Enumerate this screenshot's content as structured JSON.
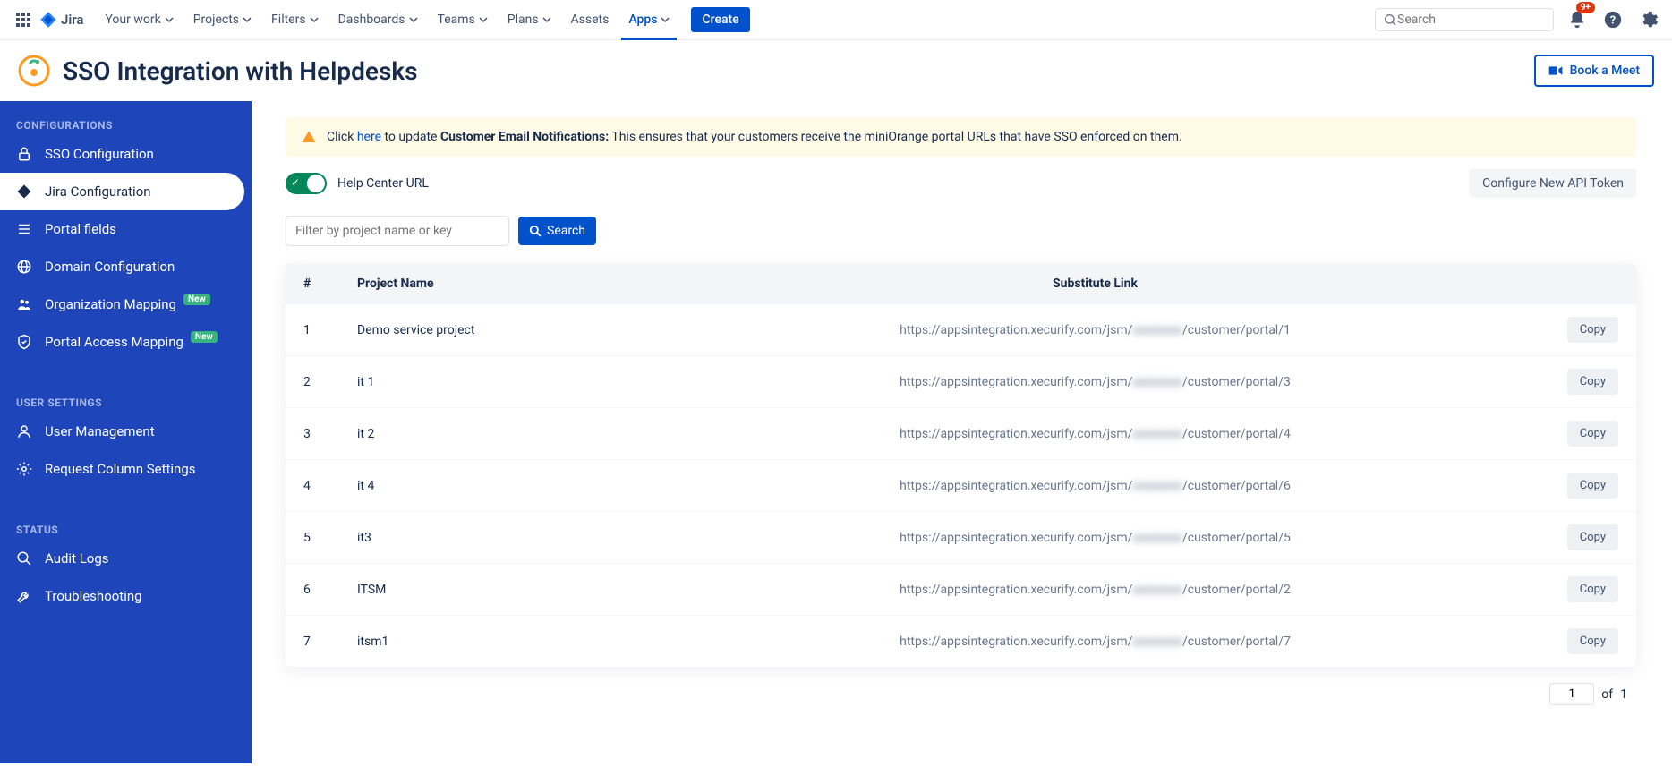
{
  "top_nav": {
    "brand": "Jira",
    "items": [
      {
        "label": "Your work",
        "dropdown": true,
        "active": false
      },
      {
        "label": "Projects",
        "dropdown": true,
        "active": false
      },
      {
        "label": "Filters",
        "dropdown": true,
        "active": false
      },
      {
        "label": "Dashboards",
        "dropdown": true,
        "active": false
      },
      {
        "label": "Teams",
        "dropdown": true,
        "active": false
      },
      {
        "label": "Plans",
        "dropdown": true,
        "active": false
      },
      {
        "label": "Assets",
        "dropdown": false,
        "active": false
      },
      {
        "label": "Apps",
        "dropdown": true,
        "active": true
      }
    ],
    "create": "Create",
    "search_placeholder": "Search",
    "notifications_badge": "9+"
  },
  "header": {
    "title": "SSO Integration with Helpdesks",
    "book_meet": "Book a Meet"
  },
  "sidebar": {
    "configurations": {
      "heading": "CONFIGURATIONS",
      "items": [
        {
          "icon": "lock-icon",
          "label": "SSO Configuration",
          "active": false,
          "new": false,
          "name": "sidebar-item-sso-config"
        },
        {
          "icon": "jira-icon",
          "label": "Jira Configuration",
          "active": true,
          "new": false,
          "name": "sidebar-item-jira-config"
        },
        {
          "icon": "list-icon",
          "label": "Portal fields",
          "active": false,
          "new": false,
          "name": "sidebar-item-portal-fields"
        },
        {
          "icon": "globe-icon",
          "label": "Domain Configuration",
          "active": false,
          "new": false,
          "name": "sidebar-item-domain-config"
        },
        {
          "icon": "users-icon",
          "label": "Organization Mapping",
          "active": false,
          "new": true,
          "name": "sidebar-item-org-mapping"
        },
        {
          "icon": "shield-icon",
          "label": "Portal Access Mapping",
          "active": false,
          "new": true,
          "name": "sidebar-item-portal-access"
        }
      ]
    },
    "user_settings": {
      "heading": "USER SETTINGS",
      "items": [
        {
          "icon": "person-icon",
          "label": "User Management",
          "name": "sidebar-item-user-management"
        },
        {
          "icon": "gear-icon",
          "label": "Request Column Settings",
          "name": "sidebar-item-request-column"
        }
      ]
    },
    "status": {
      "heading": "STATUS",
      "items": [
        {
          "icon": "search-icon",
          "label": "Audit Logs",
          "name": "sidebar-item-audit-logs"
        },
        {
          "icon": "wrench-icon",
          "label": "Troubleshooting",
          "name": "sidebar-item-troubleshooting"
        }
      ]
    },
    "new_badge_text": "New"
  },
  "alert": {
    "prefix": "Click ",
    "link": "here",
    "mid": " to update ",
    "strong": "Customer Email Notifications:",
    "rest": " This ensures that your customers receive the miniOrange portal URLs that have SSO enforced on them."
  },
  "controls": {
    "help_center": "Help Center URL",
    "api_token": "Configure New API Token"
  },
  "filter": {
    "placeholder": "Filter by project name or key",
    "search": "Search"
  },
  "table": {
    "headers": {
      "num": "#",
      "project": "Project Name",
      "link": "Substitute Link"
    },
    "copy_label": "Copy",
    "link_prefix": "https://appsintegration.xecurify.com/jsm/",
    "link_blur": "xxxxxxxx",
    "link_suffix_base": "/customer/portal/",
    "rows": [
      {
        "num": "1",
        "name": "Demo service project",
        "portal": "1"
      },
      {
        "num": "2",
        "name": "it 1",
        "portal": "3"
      },
      {
        "num": "3",
        "name": "it 2",
        "portal": "4"
      },
      {
        "num": "4",
        "name": "it 4",
        "portal": "6"
      },
      {
        "num": "5",
        "name": "it3",
        "portal": "5"
      },
      {
        "num": "6",
        "name": "ITSM",
        "portal": "2"
      },
      {
        "num": "7",
        "name": "itsm1",
        "portal": "7"
      }
    ]
  },
  "pagination": {
    "current": "1",
    "of": "of",
    "total": "1"
  }
}
